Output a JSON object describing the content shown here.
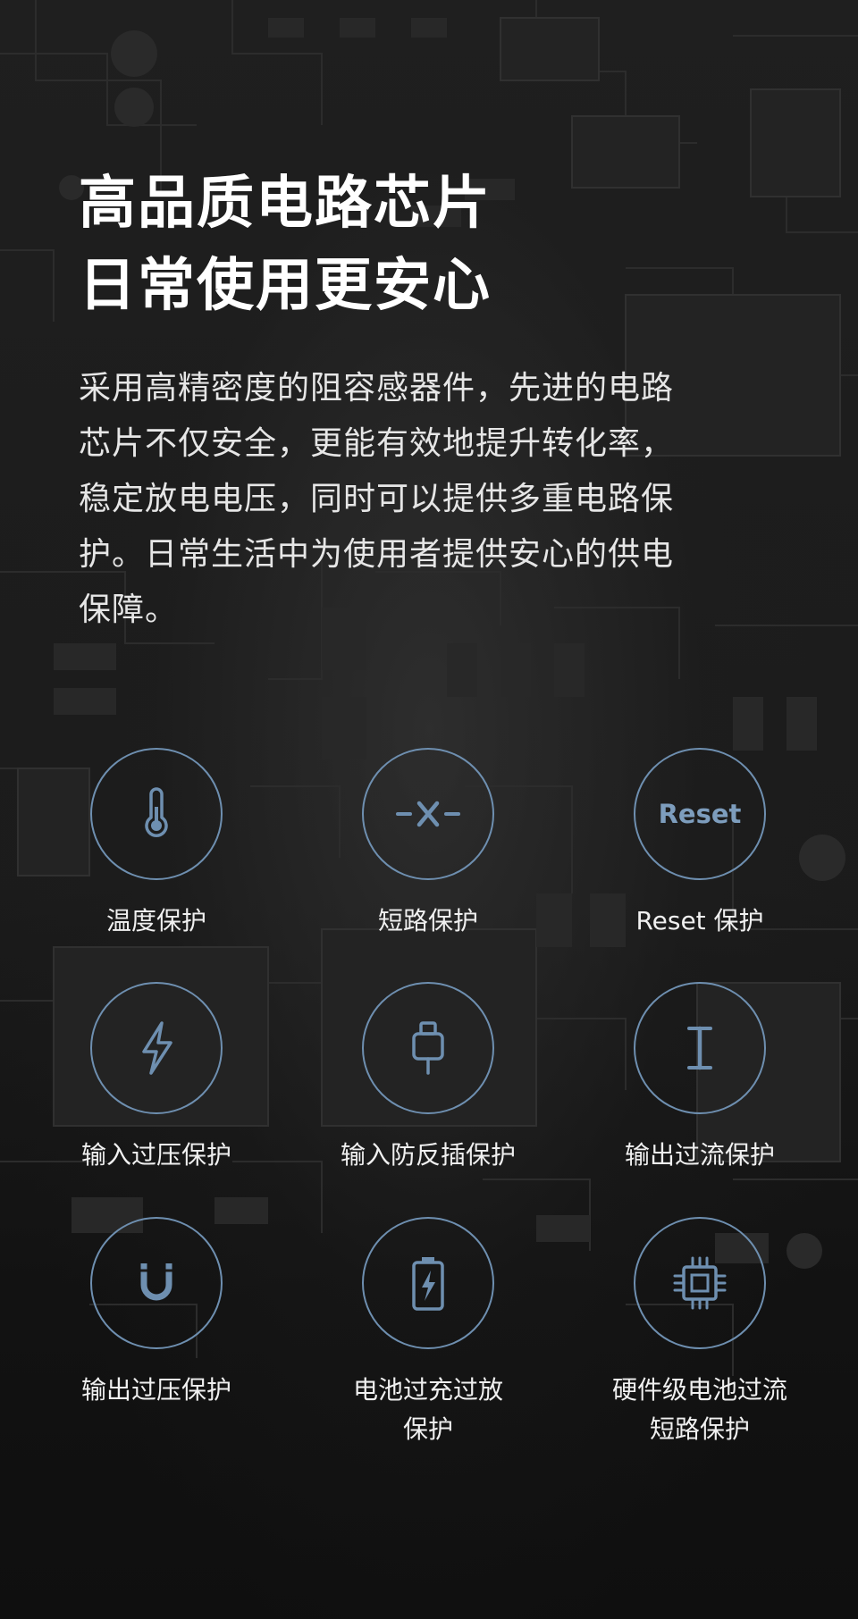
{
  "headline": {
    "line1": "高品质电路芯片",
    "line2": "日常使用更安心"
  },
  "description": {
    "line1": "采用高精密度的阻容感器件，先进的电路",
    "line2": "芯片不仅安全，更能有效地提升转化率，",
    "line3": "稳定放电电压，同时可以提供多重电路保",
    "line4": "护。日常生活中为使用者提供安心的供电",
    "line5": "保障。"
  },
  "features": [
    {
      "icon": "thermometer-icon",
      "icon_text": "",
      "label": [
        "温度保护"
      ]
    },
    {
      "icon": "short-circuit-icon",
      "icon_text": "",
      "label": [
        "短路保护"
      ]
    },
    {
      "icon": "reset-icon",
      "icon_text": "Reset",
      "label": [
        "Reset 保护"
      ]
    },
    {
      "icon": "lightning-icon",
      "icon_text": "",
      "label": [
        "输入过压保护"
      ]
    },
    {
      "icon": "plug-icon",
      "icon_text": "",
      "label": [
        "输入防反插保护"
      ]
    },
    {
      "icon": "current-icon",
      "icon_text": "",
      "label": [
        "输出过流保护"
      ]
    },
    {
      "icon": "magnet-icon",
      "icon_text": "",
      "label": [
        "输出过压保护"
      ]
    },
    {
      "icon": "battery-charge-icon",
      "icon_text": "",
      "label": [
        "电池过充过放",
        "保护"
      ]
    },
    {
      "icon": "chip-icon",
      "icon_text": "",
      "label": [
        "硬件级电池过流",
        "短路保护"
      ]
    }
  ],
  "colors": {
    "accent": "#6e8fb0",
    "background": "#161616",
    "text": "#ffffff"
  }
}
